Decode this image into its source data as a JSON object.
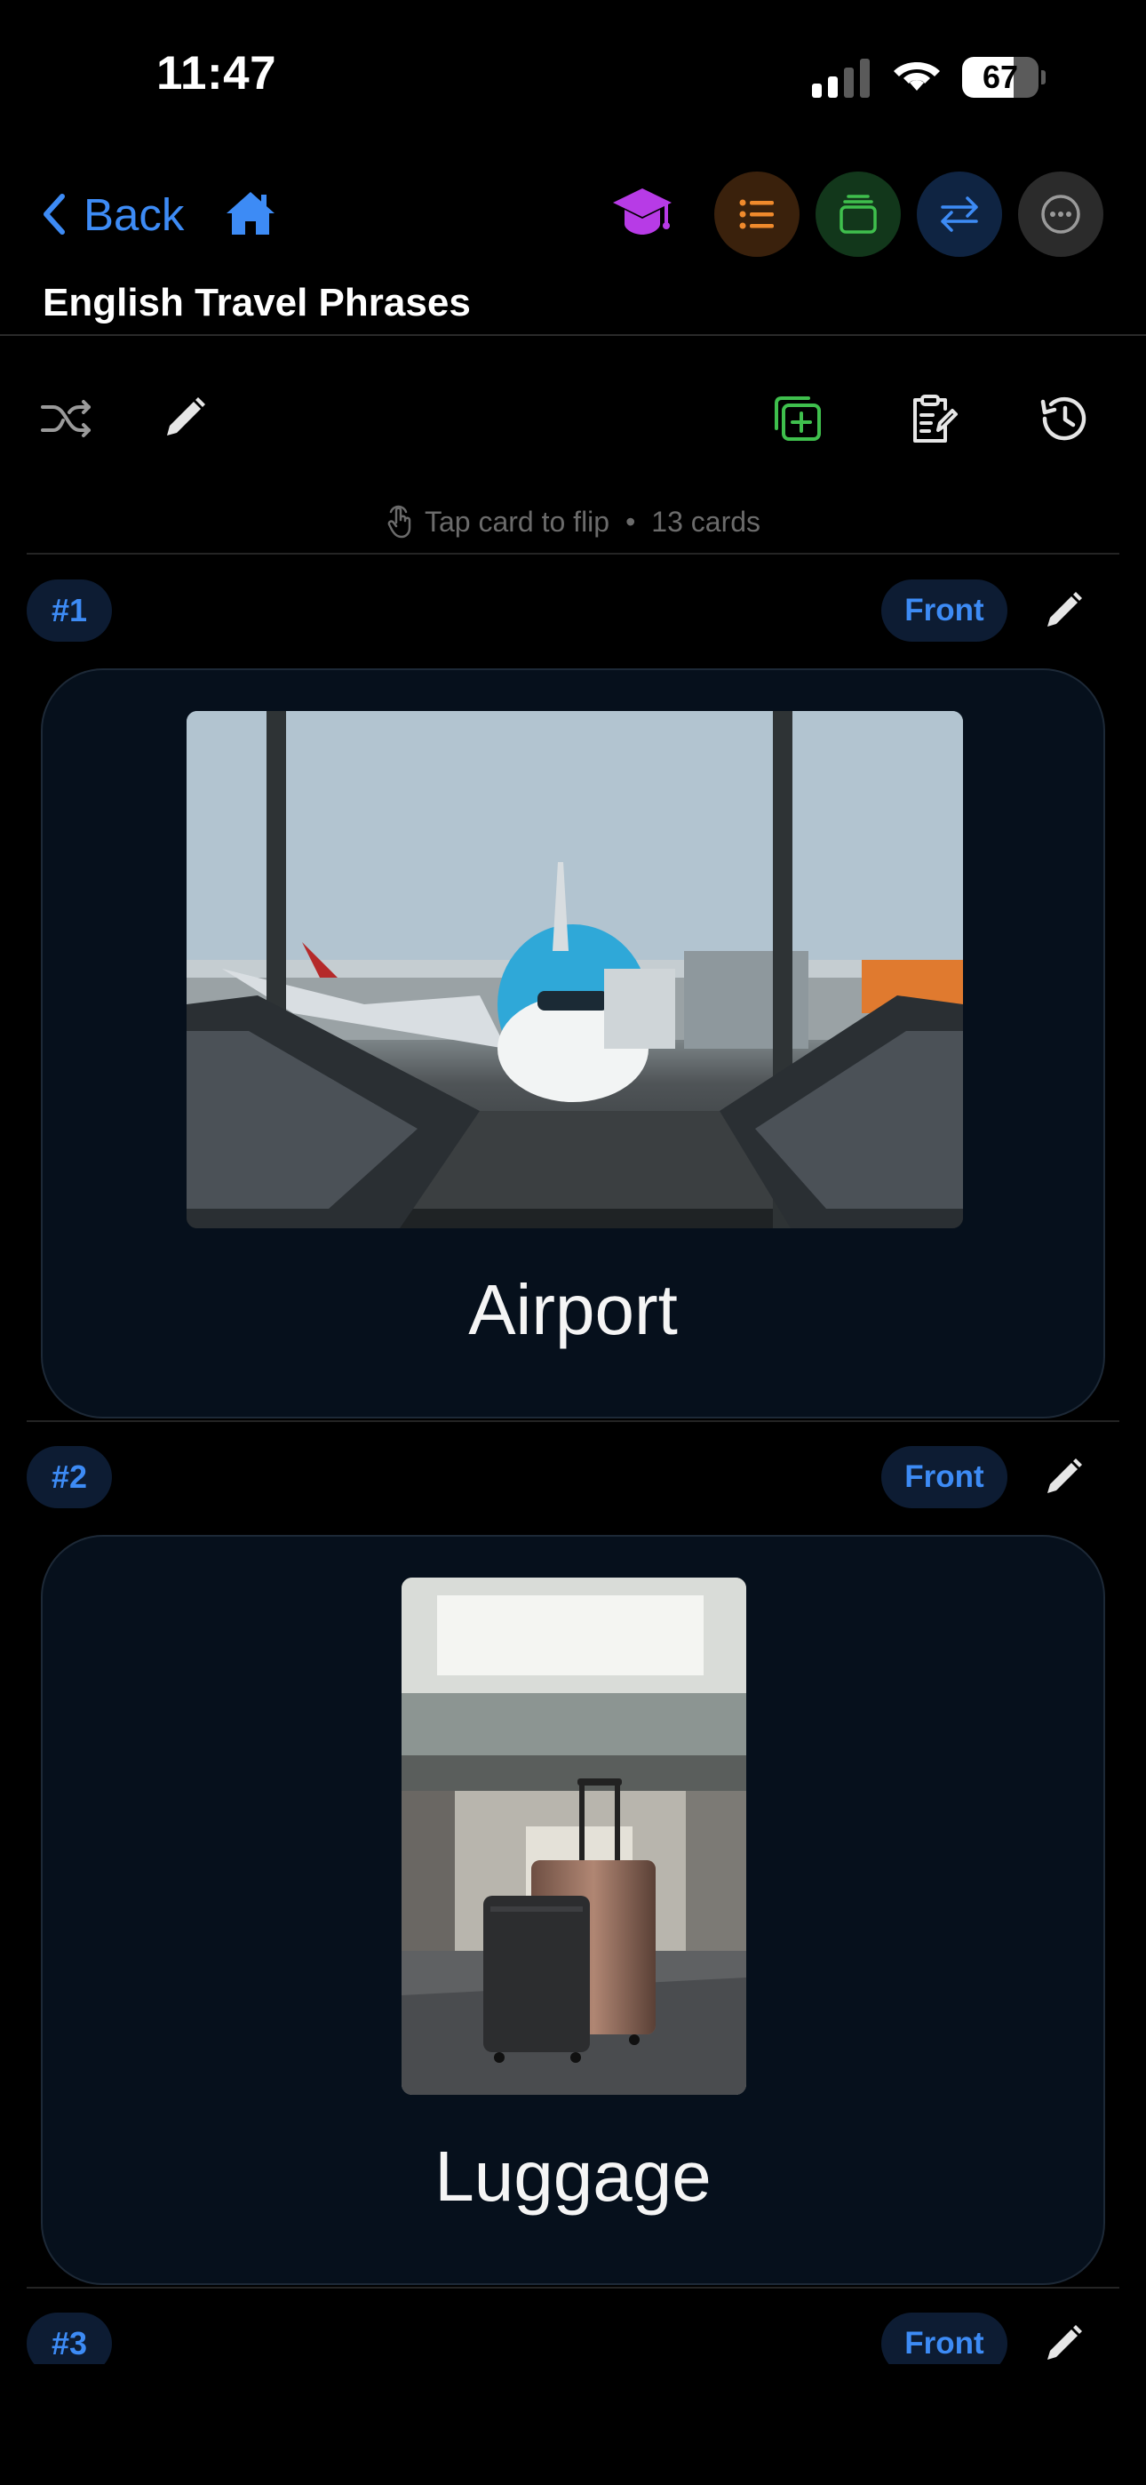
{
  "status_bar": {
    "time": "11:47",
    "battery": "67",
    "battery_level": 0.67
  },
  "nav": {
    "back_label": "Back"
  },
  "deck": {
    "title": "English Travel Phrases"
  },
  "hint": {
    "text": "Tap card to flip",
    "separator": "•",
    "count": "13 cards"
  },
  "colors": {
    "accent": "#3d8bf5",
    "card_bg": "#06101c",
    "purple": "#b73be6",
    "orange": "#f08a2c",
    "green": "#3fbf4d"
  },
  "cards": [
    {
      "number": "#1",
      "side": "Front",
      "word": "Airport",
      "image": "airport-photo"
    },
    {
      "number": "#2",
      "side": "Front",
      "word": "Luggage",
      "image": "luggage-photo"
    },
    {
      "number": "#3",
      "side": "Front"
    }
  ]
}
